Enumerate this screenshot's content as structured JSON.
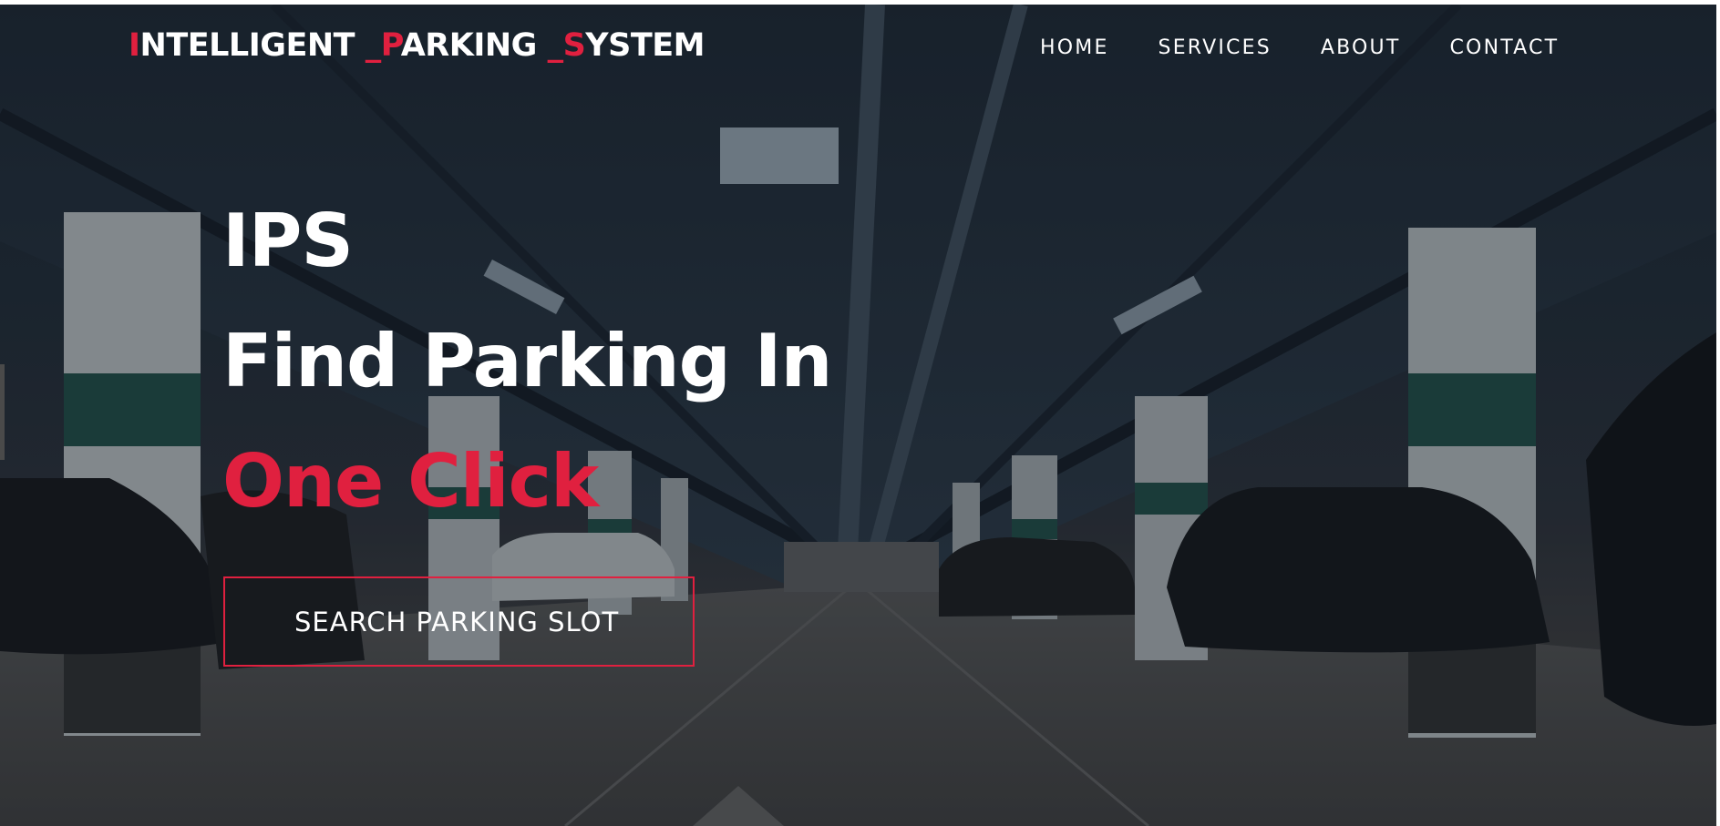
{
  "brand": {
    "part1_initial": "I",
    "part1_rest": "NTELLIGENT ",
    "part2_initial": "_P",
    "part2_rest": "ARKING ",
    "part3_initial": "_S",
    "part3_rest": "YSTEM"
  },
  "nav": {
    "items": [
      {
        "label": "HOME"
      },
      {
        "label": "SERVICES"
      },
      {
        "label": "ABOUT"
      },
      {
        "label": "CONTACT"
      }
    ]
  },
  "hero": {
    "line1": "IPS",
    "line2": "Find Parking In",
    "line3": "One Click",
    "cta_label": "SEARCH PARKING SLOT"
  },
  "colors": {
    "accent": "#e0203f",
    "text": "#ffffff",
    "hero_dark": "#1b2530"
  }
}
